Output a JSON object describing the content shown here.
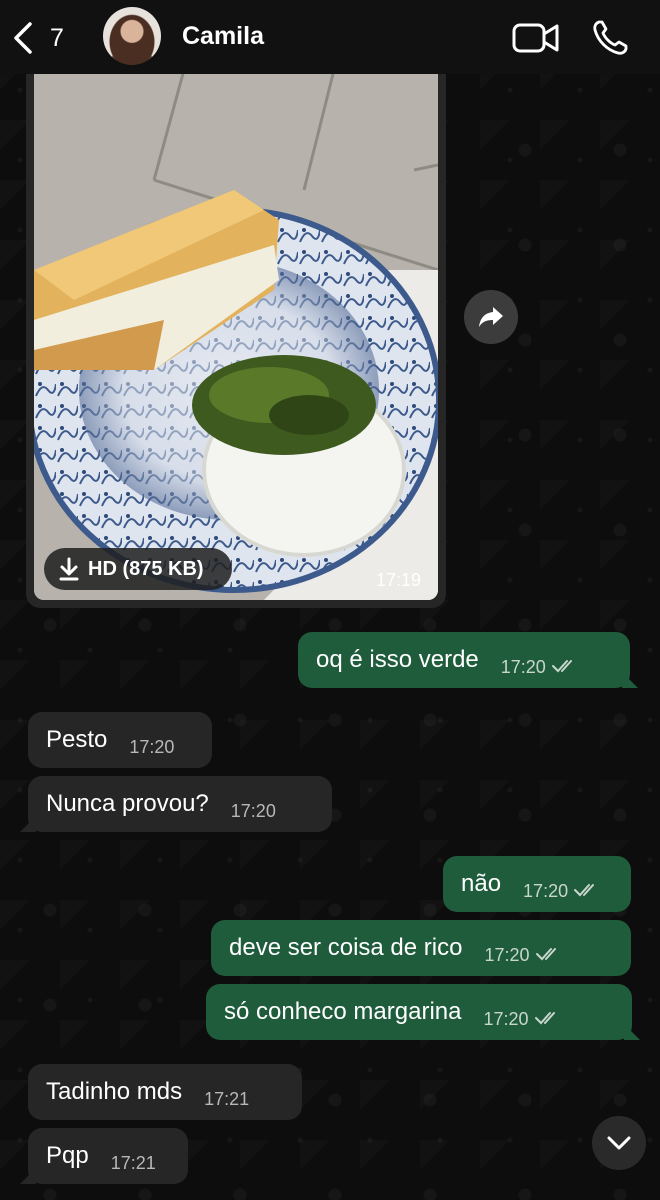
{
  "header": {
    "back_count": "7",
    "contact_name": "Camila",
    "icons": [
      "chevron-left-icon",
      "video-camera-icon",
      "phone-icon"
    ]
  },
  "image_message": {
    "download_label": "HD (875 KB)",
    "time": "17:19"
  },
  "messages": [
    {
      "dir": "out",
      "text": "oq é isso verde",
      "time": "17:20",
      "read": true
    },
    {
      "dir": "in",
      "text": "Pesto",
      "time": "17:20"
    },
    {
      "dir": "in",
      "text": "Nunca provou?",
      "time": "17:20"
    },
    {
      "dir": "out",
      "text": "não",
      "time": "17:20",
      "read": true
    },
    {
      "dir": "out",
      "text": "deve ser coisa de rico",
      "time": "17:20",
      "read": true
    },
    {
      "dir": "out",
      "text": "só conheco margarina",
      "time": "17:20",
      "read": true
    },
    {
      "dir": "in",
      "text": "Tadinho mds",
      "time": "17:21"
    },
    {
      "dir": "in",
      "text": "Pqp",
      "time": "17:21"
    }
  ],
  "colors": {
    "outgoing_bubble": "#1e5c3c",
    "incoming_bubble": "#262626",
    "background": "#0b0b0b"
  }
}
